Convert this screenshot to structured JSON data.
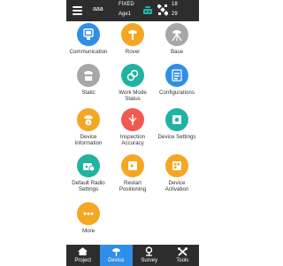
{
  "topbar": {
    "project_name": "aaa",
    "solution_status": "FIXED",
    "age": "Age1",
    "sat_used": "18",
    "sat_visible": "29",
    "bar_color": "#2d2d2d"
  },
  "colors": {
    "blue": "#2f8ee8",
    "orange": "#f5a623",
    "gray": "#a7a7a7",
    "teal": "#20b3a1",
    "red": "#f05a4f",
    "active_nav": "#2f8ee8"
  },
  "items": [
    {
      "label": "Communication",
      "icon": "communication-icon",
      "color": "blue"
    },
    {
      "label": "Rover",
      "icon": "rover-icon",
      "color": "orange"
    },
    {
      "label": "Base",
      "icon": "base-icon",
      "color": "gray"
    },
    {
      "label": "Static",
      "icon": "static-icon",
      "color": "gray"
    },
    {
      "label": "Work Mode\nStatus",
      "icon": "work-mode-icon",
      "color": "teal"
    },
    {
      "label": "Configurations",
      "icon": "configurations-icon",
      "color": "blue"
    },
    {
      "label": "Device\nInformation",
      "icon": "device-info-icon",
      "color": "orange"
    },
    {
      "label": "Inspection\nAccuracy",
      "icon": "inspection-icon",
      "color": "red"
    },
    {
      "label": "Device Settings",
      "icon": "device-settings-icon",
      "color": "teal"
    },
    {
      "label": "Default Radio\nSettings",
      "icon": "radio-settings-icon",
      "color": "teal"
    },
    {
      "label": "Restart\nPositioning",
      "icon": "restart-icon",
      "color": "orange"
    },
    {
      "label": "Device\nActivation",
      "icon": "activation-icon",
      "color": "orange"
    },
    {
      "label": "More",
      "icon": "more-icon",
      "color": "orange"
    }
  ],
  "nav": [
    {
      "label": "Project",
      "icon": "home-icon",
      "active": false
    },
    {
      "label": "Device",
      "icon": "device-icon",
      "active": true
    },
    {
      "label": "Survey",
      "icon": "survey-icon",
      "active": false
    },
    {
      "label": "Tools",
      "icon": "tools-icon",
      "active": false
    }
  ]
}
